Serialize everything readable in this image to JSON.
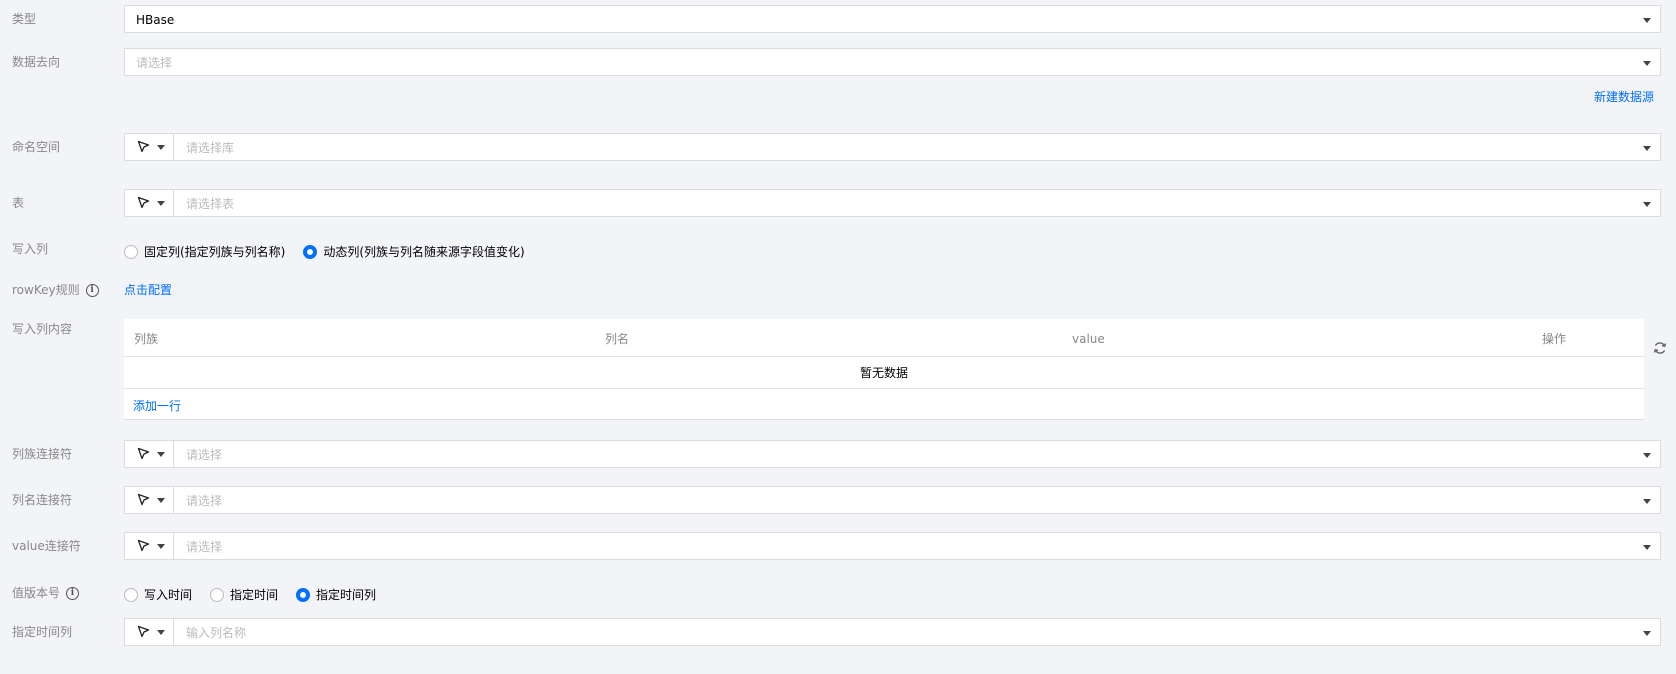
{
  "type": {
    "label": "类型",
    "value": "HBase"
  },
  "destination": {
    "label": "数据去向",
    "placeholder": "请选择"
  },
  "new_datasource_link": "新建数据源",
  "namespace": {
    "label": "命名空间",
    "placeholder": "请选择库"
  },
  "table_select": {
    "label": "表",
    "placeholder": "请选择表"
  },
  "write_columns": {
    "label": "写入列",
    "options": [
      {
        "label": "固定列(指定列族与列名称)",
        "checked": false
      },
      {
        "label": "动态列(列族与列名随来源字段值变化)",
        "checked": true
      }
    ]
  },
  "rowkey": {
    "label": "rowKey规则",
    "link": "点击配置"
  },
  "write_content": {
    "label": "写入列内容",
    "columns": [
      "列族",
      "列名",
      "value",
      "操作"
    ],
    "empty_text": "暂无数据",
    "add_row": "添加一行"
  },
  "family_connector": {
    "label": "列族连接符",
    "placeholder": "请选择"
  },
  "name_connector": {
    "label": "列名连接符",
    "placeholder": "请选择"
  },
  "value_connector": {
    "label": "value连接符",
    "placeholder": "请选择"
  },
  "version": {
    "label": "值版本号",
    "options": [
      {
        "label": "写入时间",
        "checked": false
      },
      {
        "label": "指定时间",
        "checked": false
      },
      {
        "label": "指定时间列",
        "checked": true
      }
    ]
  },
  "time_column": {
    "label": "指定时间列",
    "placeholder": "输入列名称"
  },
  "colors": {
    "accent": "#006eff",
    "label": "#888888",
    "background": "#f3f4f7",
    "border": "#dcdcdc"
  },
  "icons": {
    "mode": "cursor-arrow-icon",
    "caret": "caret-down-icon",
    "info": "info-icon",
    "refresh": "refresh-icon"
  }
}
